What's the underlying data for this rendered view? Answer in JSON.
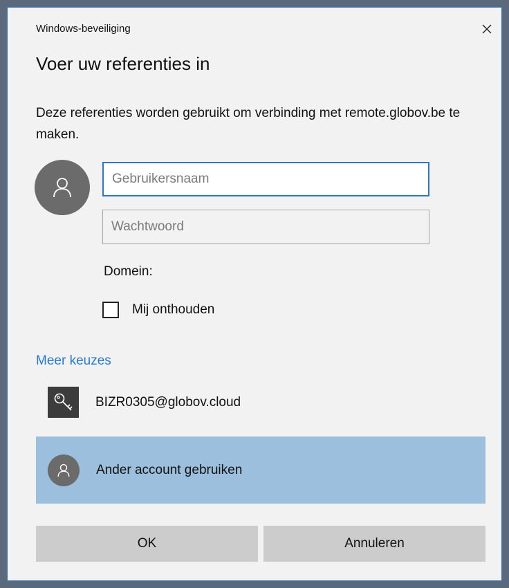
{
  "window": {
    "title": "Windows-beveiliging",
    "close_glyph": "✕"
  },
  "dialog": {
    "heading": "Voer uw referenties in",
    "description": "Deze referenties worden gebruikt om verbinding met remote.globov.be te maken."
  },
  "form": {
    "username": {
      "value": "",
      "placeholder": "Gebruikersnaam"
    },
    "password": {
      "value": "",
      "placeholder": "Wachtwoord"
    },
    "domain_label": "Domein:",
    "remember_label": "Mij onthouden",
    "remember_checked": false
  },
  "more_choices": {
    "label": "Meer keuzes",
    "accounts": [
      {
        "label": "BIZR0305@globov.cloud",
        "icon": "key-icon",
        "selected": false
      },
      {
        "label": "Ander account gebruiken",
        "icon": "user-icon",
        "selected": true
      }
    ]
  },
  "buttons": {
    "ok_label": "OK",
    "cancel_label": "Annuleren"
  },
  "colors": {
    "accent": "#2b77c8",
    "link": "#2a79d0",
    "selected_row": "#9dbfde",
    "button_bg": "#cccccc",
    "dialog_bg": "#f2f2f2",
    "avatar_bg": "#6b6b6b"
  }
}
